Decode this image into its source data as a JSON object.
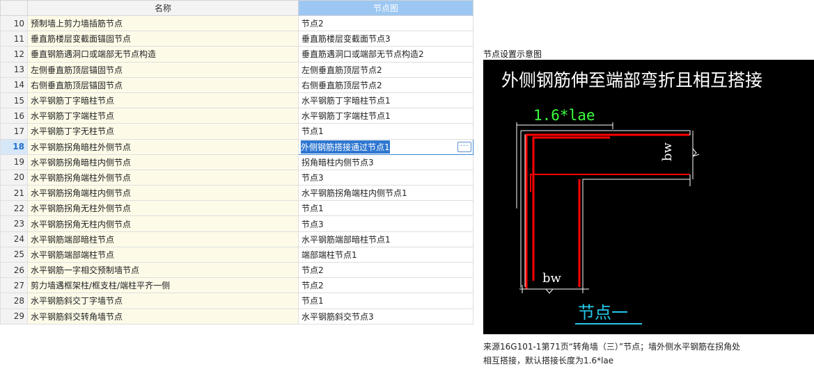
{
  "table": {
    "headers": {
      "index": "",
      "name": "名称",
      "node": "节点图"
    },
    "selected_index": "18",
    "rows": [
      {
        "index": "10",
        "name": "预制墙上剪力墙插筋节点",
        "node": "节点2"
      },
      {
        "index": "11",
        "name": "垂直筋楼层变截面锚固节点",
        "node": "垂直筋楼层变截面节点3"
      },
      {
        "index": "12",
        "name": "垂直钢筋遇洞口或端部无节点构造",
        "node": "垂直筋遇洞口或端部无节点构造2"
      },
      {
        "index": "13",
        "name": "左侧垂直筋顶层锚固节点",
        "node": "左侧垂直筋顶层节点2"
      },
      {
        "index": "14",
        "name": "右侧垂直筋顶层锚固节点",
        "node": "右侧垂直筋顶层节点2"
      },
      {
        "index": "15",
        "name": "水平钢筋丁字暗柱节点",
        "node": "水平钢筋丁字暗柱节点1"
      },
      {
        "index": "16",
        "name": "水平钢筋丁字端柱节点",
        "node": "水平钢筋丁字端柱节点1"
      },
      {
        "index": "17",
        "name": "水平钢筋丁字无柱节点",
        "node": "节点1"
      },
      {
        "index": "18",
        "name": "水平钢筋拐角暗柱外侧节点",
        "node": "外侧钢筋搭接通过节点1"
      },
      {
        "index": "19",
        "name": "水平钢筋拐角暗柱内侧节点",
        "node": "拐角暗柱内侧节点3"
      },
      {
        "index": "20",
        "name": "水平钢筋拐角端柱外侧节点",
        "node": "节点3"
      },
      {
        "index": "21",
        "name": "水平钢筋拐角端柱内侧节点",
        "node": "水平钢筋拐角端柱内侧节点1"
      },
      {
        "index": "22",
        "name": "水平钢筋拐角无柱外侧节点",
        "node": "节点1"
      },
      {
        "index": "23",
        "name": "水平钢筋拐角无柱内侧节点",
        "node": "节点3"
      },
      {
        "index": "24",
        "name": "水平钢筋端部暗柱节点",
        "node": "水平钢筋端部暗柱节点1"
      },
      {
        "index": "25",
        "name": "水平钢筋端部端柱节点",
        "node": "端部端柱节点1"
      },
      {
        "index": "26",
        "name": "水平钢筋一字相交预制墙节点",
        "node": "节点2"
      },
      {
        "index": "27",
        "name": "剪力墙遇框架柱/框支柱/端柱平齐一侧",
        "node": "节点2"
      },
      {
        "index": "28",
        "name": "水平钢筋斜交丁字墙节点",
        "node": "节点1"
      },
      {
        "index": "29",
        "name": "水平钢筋斜交转角墙节点",
        "node": "水平钢筋斜交节点3"
      }
    ],
    "edit_button_label": "···"
  },
  "preview": {
    "panel_title": "节点设置示意图",
    "diagram_heading": "外侧钢筋伸至端部弯折且相互搭接",
    "lap_label": "1.6*lae",
    "bw_right": "bw",
    "bw_bottom": "bw",
    "node_label": "节点一",
    "caption_line1": "来源16G101-1第71页“转角墙（三）”节点；墙外侧水平钢筋在拐角处",
    "caption_line2": "相互搭接，默认搭接长度为1.6*lae"
  },
  "colors": {
    "header_accent": "#9cc7f2",
    "name_cell_bg": "#fdfbe8",
    "selection_blue": "#2f77d0",
    "rebar_red": "#ff0000",
    "lap_green": "#3cff3c",
    "node_cyan": "#22c8e8"
  }
}
